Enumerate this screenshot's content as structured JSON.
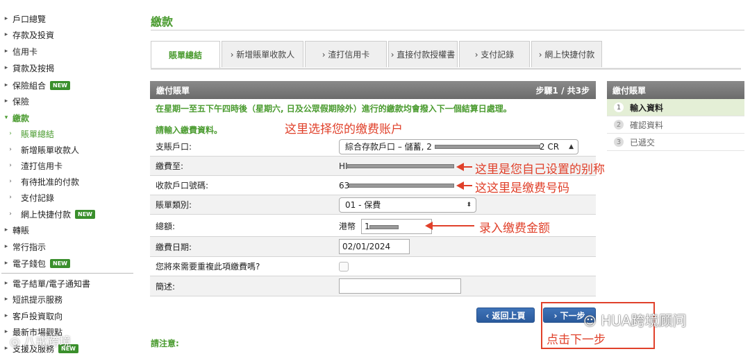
{
  "sidebar": {
    "items": [
      {
        "label": "戶口總覽"
      },
      {
        "label": "存款及投資"
      },
      {
        "label": "信用卡"
      },
      {
        "label": "貸款及按揭"
      },
      {
        "label": "保險組合",
        "badge": "NEW"
      },
      {
        "label": "保險"
      },
      {
        "label": "繳款"
      },
      {
        "label": "賬單總結"
      },
      {
        "label": "新增賬單收款人"
      },
      {
        "label": "渣打信用卡"
      },
      {
        "label": "有待批准的付款"
      },
      {
        "label": "支付記錄"
      },
      {
        "label": "網上快捷付款",
        "badge": "NEW"
      },
      {
        "label": "轉賬"
      },
      {
        "label": "常行指示"
      },
      {
        "label": "電子錢包",
        "badge": "NEW"
      },
      {
        "label": "電子結單/電子通知書"
      },
      {
        "label": "短訊提示服務"
      },
      {
        "label": "客戶投資取向"
      },
      {
        "label": "最新市場觀點"
      },
      {
        "label": "支援及服務",
        "badge": "NEW"
      }
    ]
  },
  "page": {
    "title": "繳款",
    "tabs": [
      {
        "label": "賬單總結"
      },
      {
        "label": "› 新增賬單收款人"
      },
      {
        "label": "› 渣打信用卡"
      },
      {
        "label": "› 直接付款授權書"
      },
      {
        "label": "› 支付記錄"
      },
      {
        "label": "› 網上快捷付款"
      }
    ]
  },
  "form": {
    "header_title": "繳付賬單",
    "step_indicator": "步驟1 / 共3步",
    "notice": "在星期一至五下午四時後（星期六, 日及公眾假期除外）進行的繳款均會撥入下一個結算日處理。",
    "prompt": "請輸入繳費資料。",
    "debit_account": {
      "label": "支賬戶口:",
      "value_prefix": "綜合存款戶口 – 儲蓄, 2",
      "value_suffix": "2 CR"
    },
    "pay_to": {
      "label": "繳費至:",
      "value": "HI"
    },
    "payee_account": {
      "label": "收款戶口號碼:",
      "value": "63"
    },
    "bill_type": {
      "label": "賬單類別:",
      "value": "01 - 保費"
    },
    "amount": {
      "label": "總額:",
      "currency": "港幣",
      "value": "1"
    },
    "pay_date": {
      "label": "繳費日期:",
      "value": "02/01/2024"
    },
    "repeat": {
      "label": "您將來需要重複此項繳費嗎?"
    },
    "remark": {
      "label": "簡述:",
      "value": ""
    }
  },
  "steps": {
    "title": "繳付賬單",
    "items": [
      {
        "num": "1",
        "label": "輸入資料"
      },
      {
        "num": "2",
        "label": "確認資料"
      },
      {
        "num": "3",
        "label": "已遞交"
      }
    ]
  },
  "buttons": {
    "back": "‹ 返回上頁",
    "next": "› 下一步"
  },
  "footer": {
    "note": "請注意:"
  },
  "annotations": {
    "account": "这里选择您的缴费账户",
    "alias": "这里是您自己设置的别称",
    "number": "这这里是缴费号码",
    "amount": "录入缴费金额",
    "next": "点击下一步"
  },
  "watermarks": {
    "right": "HUA跨境顾问",
    "left": "八戒跨境"
  },
  "colors": {
    "accent": "#4a9b2f",
    "annotation": "#e0402a",
    "button": "#2a5a9c"
  }
}
